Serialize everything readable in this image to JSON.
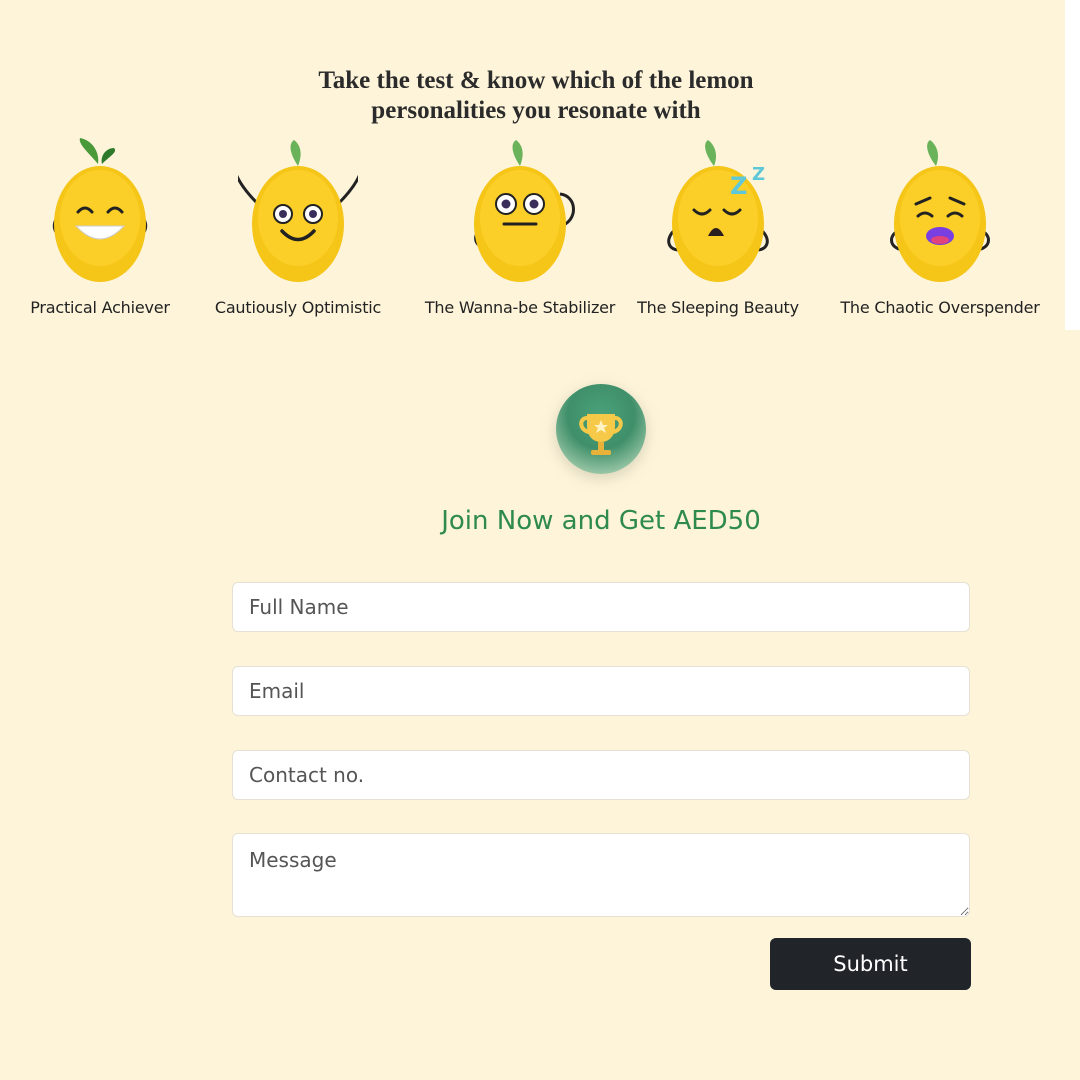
{
  "header": {
    "headline_line1": "Take the test & know which of the lemon",
    "headline_line2": "personalities you resonate with"
  },
  "personalities": [
    {
      "label": "Practical Achiever",
      "icon": "grinning-lemon-icon"
    },
    {
      "label": "Cautiously Optimistic",
      "icon": "smiling-lemon-icon"
    },
    {
      "label": "The Wanna-be Stabilizer",
      "icon": "neutral-lemon-icon"
    },
    {
      "label": "The Sleeping Beauty",
      "icon": "sleeping-lemon-icon"
    },
    {
      "label": "The Chaotic Overspender",
      "icon": "worried-lemon-icon"
    }
  ],
  "form": {
    "icon": "trophy-icon",
    "title": "Join Now and Get AED50",
    "full_name_placeholder": "Full Name",
    "email_placeholder": "Email",
    "contact_placeholder": "Contact no.",
    "message_placeholder": "Message",
    "submit_label": "Submit"
  },
  "colors": {
    "background": "#fdf4da",
    "title_green": "#2f8a4e",
    "submit_bg": "#212529",
    "lemon_yellow": "#f5c518"
  }
}
